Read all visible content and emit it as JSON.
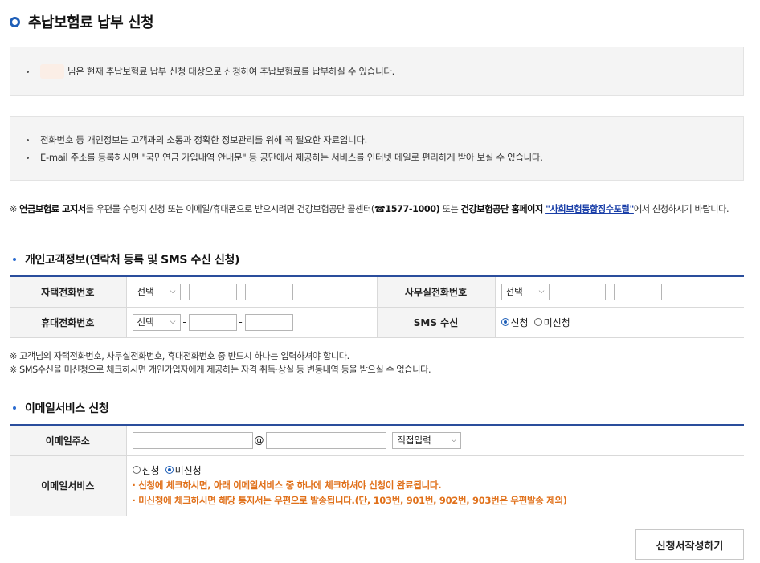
{
  "page_title": "추납보험료 납부 신청",
  "notice1": {
    "text": "님은 현재 추납보험료 납부 신청 대상으로 신청하여 추납보험료를 납부하실 수 있습니다."
  },
  "notice2": {
    "lines": [
      "전화번호 등 개인정보는 고객과의 소통과 정확한 정보관리를 위해 꼭 필요한 자료입니다.",
      "E-mail 주소를 등록하시면 \"국민연금 가입내역 안내문\" 등 공단에서 제공하는 서비스를 인터넷 메일로 편리하게 받아 보실 수 있습니다."
    ]
  },
  "remark": {
    "prefix": "※ ",
    "bold1": "연금보험료 고지서",
    "text1": "를 우편물 수령지 신청 또는 이메일/휴대폰으로 받으시려면 건강보험공단 콜센터(",
    "bold2": "☎1577-1000)",
    "text2": " 또는 ",
    "bold3": "건강보험공단 홈페이지",
    "text3": " ",
    "link": "\"사회보험통합징수포털\"",
    "text4": "에서 신청하시기 바랍니다."
  },
  "section1": {
    "title": "개인고객정보(연락처 등록 및 SMS 수신 신청)",
    "home_phone_label": "자택전화번호",
    "office_phone_label": "사무실전화번호",
    "mobile_label": "휴대전화번호",
    "sms_label": "SMS 수신",
    "select_value": "선택",
    "dash": "-",
    "sms_options": [
      "신청",
      "미신청"
    ],
    "sms_selected": "신청"
  },
  "section1_notes": [
    "※ 고객님의 자택전화번호, 사무실전화번호, 휴대전화번호 중 반드시 하나는 입력하셔야 합니다.",
    "※ SMS수신을 미신청으로 체크하시면 개인가입자에게 제공하는 자격 취득·상실 등 변동내역 등을 받으실 수 없습니다."
  ],
  "section2": {
    "title": "이메일서비스 신청",
    "email_label": "이메일주소",
    "at": "@",
    "domain_select": "직접입력",
    "service_label": "이메일서비스",
    "service_options": [
      "신청",
      "미신청"
    ],
    "service_selected": "미신청",
    "warnings": [
      "· 신청에 체크하시면, 아래 이메일서비스 중 하나에 체크하셔야 신청이 완료됩니다.",
      "· 미신청에 체크하시면 해당 통지서는 우편으로 발송됩니다.(단, 103번, 901번, 902번, 903번은 우편발송 제외)"
    ]
  },
  "submit_label": "신청서작성하기",
  "colors": {
    "accent": "#1f5fb8",
    "table_border": "#2a4d9c",
    "warning": "#e0701a",
    "link": "#1a3fa8"
  }
}
